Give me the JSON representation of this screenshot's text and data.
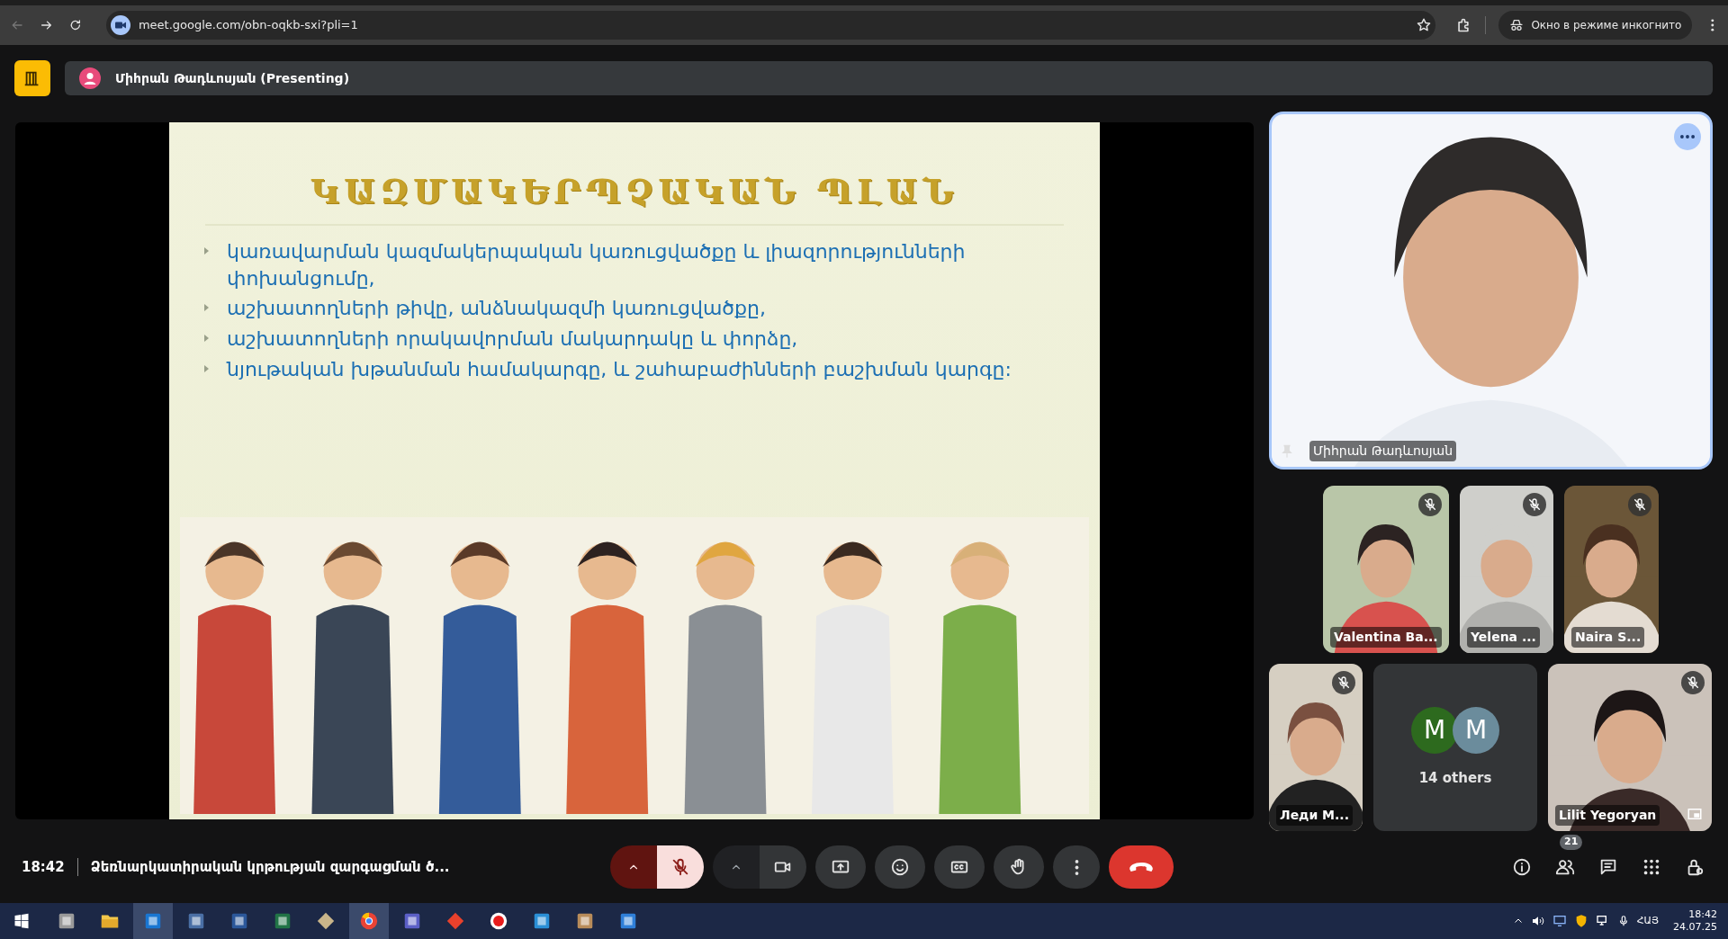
{
  "browser": {
    "url": "meet.google.com/obn-oqkb-sxi?pli=1",
    "incognito_label": "Окно в режиме инкогнито"
  },
  "header": {
    "presenter": "Միհրան Թադևոսյան (Presenting)"
  },
  "slide": {
    "title": "ԿԱԶՄԱԿԵՐՊՉԱԿԱՆ ՊԼԱՆ",
    "bullets": [
      "կառավարման կազմակերպական կառուցվածքը և լիազորությունների փոխանցումը,",
      "աշխատողների թիվը, անձնակազմի կառուցվածքը,",
      "աշխատողների որակավորման մակարդակը և փորձը,",
      "նյութական խթանման համակարգը, և շահաբաժինների բաշխման կարգը:"
    ]
  },
  "spotlight": {
    "name": "Միհրան Թադևոսյան",
    "pinned": true
  },
  "participants": [
    {
      "kind": "video",
      "name": "Valentina Ba...",
      "muted": true
    },
    {
      "kind": "video",
      "name": "Yelena ...",
      "muted": true
    },
    {
      "kind": "video",
      "name": "Naira S...",
      "muted": true
    },
    {
      "kind": "video",
      "name": "Леди М...",
      "muted": true
    },
    {
      "kind": "others",
      "label": "14 others",
      "avatars": [
        {
          "initial": "M",
          "color": "#2d6a1e"
        },
        {
          "initial": "M",
          "color": "#6b8c9c"
        }
      ]
    },
    {
      "kind": "self",
      "name": "Lilit Yegoryan",
      "muted": true
    }
  ],
  "meeting": {
    "time": "18:42",
    "title": "Ձեռնարկատիրական կրթության զարգացման ծ..."
  },
  "controls": {
    "mic_muted": true,
    "camera_on": true
  },
  "participant_count": "21",
  "taskbar": {
    "apps": [
      {
        "kind": "grey",
        "selected": false
      },
      {
        "kind": "folder",
        "selected": false
      },
      {
        "kind": "mail",
        "selected": true
      },
      {
        "kind": "calc",
        "selected": false
      },
      {
        "kind": "word",
        "selected": false
      },
      {
        "kind": "excel",
        "selected": false
      },
      {
        "kind": "tool",
        "selected": false
      },
      {
        "kind": "browser",
        "selected": true
      },
      {
        "kind": "teams",
        "selected": false
      },
      {
        "kind": "remote",
        "selected": false
      },
      {
        "kind": "record",
        "selected": false
      },
      {
        "kind": "snip",
        "selected": false
      },
      {
        "kind": "stack",
        "selected": false
      },
      {
        "kind": "board",
        "selected": false
      }
    ],
    "language": "ՀԱՅ",
    "time": "18:42",
    "date": "24.07.25"
  }
}
